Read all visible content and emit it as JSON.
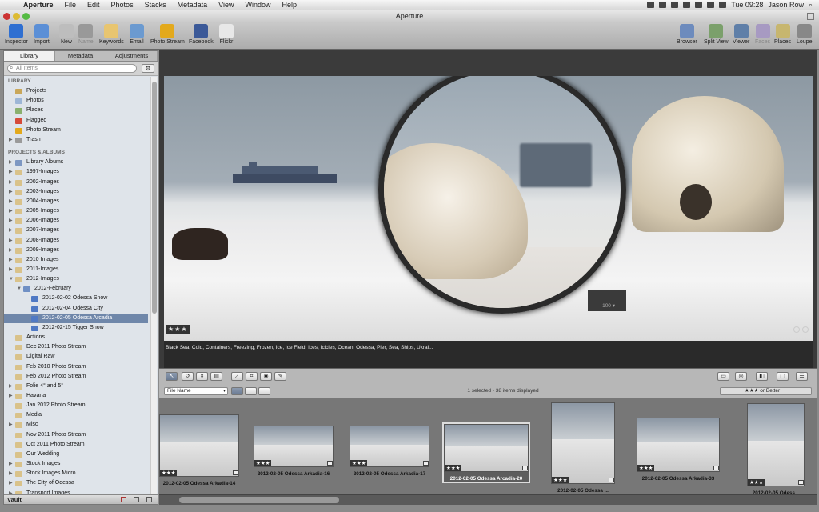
{
  "menubar": {
    "app": "Aperture",
    "items": [
      "File",
      "Edit",
      "Photos",
      "Stacks",
      "Metadata",
      "View",
      "Window",
      "Help"
    ],
    "clock": "Tue 09:28",
    "user": "Jason Row"
  },
  "window": {
    "title": "Aperture"
  },
  "toolbar": {
    "left": [
      {
        "label": "Inspector",
        "icon": "info-icon",
        "color": "#2f6fd1"
      },
      {
        "label": "Import",
        "icon": "import-arrow-icon",
        "color": "#5b8fd6"
      },
      {
        "label": "New",
        "icon": "new-icon",
        "color": "#bdbdbd"
      },
      {
        "label": "Name",
        "icon": "name-person-icon",
        "color": "#999999"
      },
      {
        "label": "Keywords",
        "icon": "keywords-tag-icon",
        "color": "#e8c570"
      },
      {
        "label": "Email",
        "icon": "email-icon",
        "color": "#6b9ad0"
      },
      {
        "label": "Photo Stream",
        "icon": "photo-stream-sunflower-icon",
        "color": "#e3a91c"
      },
      {
        "label": "Facebook",
        "icon": "facebook-icon",
        "color": "#3b5998"
      },
      {
        "label": "Flickr",
        "icon": "flickr-icon",
        "color": "#e8e8e8"
      }
    ],
    "right": [
      {
        "label": "Browser",
        "icon": "browser-grid-icon",
        "color": "#6d8bbd"
      },
      {
        "label": "Split View",
        "icon": "split-view-icon",
        "color": "#7ba06b"
      },
      {
        "label": "Viewer",
        "icon": "viewer-icon",
        "color": "#5f7fa8"
      },
      {
        "label": "Faces",
        "icon": "faces-icon",
        "color": "#a79ac2"
      },
      {
        "label": "Places",
        "icon": "places-map-icon",
        "color": "#c7b66f"
      },
      {
        "label": "Loupe",
        "icon": "loupe-icon",
        "color": "#888888"
      }
    ]
  },
  "sidebar": {
    "tabs": [
      "Library",
      "Metadata",
      "Adjustments"
    ],
    "search_placeholder": "All Items",
    "library_header": "LIBRARY",
    "library_items": [
      {
        "label": "Projects",
        "color": "#c9a75a"
      },
      {
        "label": "Photos",
        "color": "#9db6d6"
      },
      {
        "label": "Places",
        "color": "#8ab06e"
      },
      {
        "label": "Flagged",
        "color": "#d64b3a"
      },
      {
        "label": "Photo Stream",
        "color": "#e3a91c"
      },
      {
        "label": "Trash",
        "color": "#9a9a9a"
      }
    ],
    "projects_header": "PROJECTS & ALBUMS",
    "projects": [
      {
        "label": "Library Albums",
        "depth": 0,
        "tri": "▶",
        "color": "#7d97c2"
      },
      {
        "label": "1997-Images",
        "depth": 0,
        "tri": "▶",
        "color": "#d9c28a"
      },
      {
        "label": "2002-Images",
        "depth": 0,
        "tri": "▶",
        "color": "#d9c28a"
      },
      {
        "label": "2003-Images",
        "depth": 0,
        "tri": "▶",
        "color": "#d9c28a"
      },
      {
        "label": "2004-Images",
        "depth": 0,
        "tri": "▶",
        "color": "#d9c28a"
      },
      {
        "label": "2005-Images",
        "depth": 0,
        "tri": "▶",
        "color": "#d9c28a"
      },
      {
        "label": "2006-Images",
        "depth": 0,
        "tri": "▶",
        "color": "#d9c28a"
      },
      {
        "label": "2007-Images",
        "depth": 0,
        "tri": "▶",
        "color": "#d9c28a"
      },
      {
        "label": "2008-Images",
        "depth": 0,
        "tri": "▶",
        "color": "#d9c28a"
      },
      {
        "label": "2009-Images",
        "depth": 0,
        "tri": "▶",
        "color": "#d9c28a"
      },
      {
        "label": "2010 Images",
        "depth": 0,
        "tri": "▶",
        "color": "#d9c28a"
      },
      {
        "label": "2011-Images",
        "depth": 0,
        "tri": "▶",
        "color": "#d9c28a"
      },
      {
        "label": "2012-Images",
        "depth": 0,
        "tri": "▼",
        "color": "#d9c28a"
      },
      {
        "label": "2012-February",
        "depth": 1,
        "tri": "▼",
        "color": "#6f8fc4"
      },
      {
        "label": "2012-02-02 Odessa Snow",
        "depth": 2,
        "tri": "",
        "color": "#4f79c4"
      },
      {
        "label": "2012-02-04 Odessa City",
        "depth": 2,
        "tri": "",
        "color": "#4f79c4"
      },
      {
        "label": "2012-02-05 Odessa Arcadia",
        "depth": 2,
        "tri": "",
        "color": "#4f79c4",
        "selected": true
      },
      {
        "label": "2012-02-15 Tigger Snow",
        "depth": 2,
        "tri": "",
        "color": "#4f79c4"
      },
      {
        "label": "Actions",
        "depth": 0,
        "tri": "",
        "color": "#d9c28a"
      },
      {
        "label": "Dec 2011 Photo Stream",
        "depth": 0,
        "tri": "",
        "color": "#d9c28a"
      },
      {
        "label": "Digital Raw",
        "depth": 0,
        "tri": "",
        "color": "#d9c28a"
      },
      {
        "label": "Feb 2010 Photo Stream",
        "depth": 0,
        "tri": "",
        "color": "#d9c28a"
      },
      {
        "label": "Feb 2012 Photo Stream",
        "depth": 0,
        "tri": "",
        "color": "#d9c28a"
      },
      {
        "label": "Folie 4° and 5°",
        "depth": 0,
        "tri": "▶",
        "color": "#d9c28a"
      },
      {
        "label": "Havana",
        "depth": 0,
        "tri": "▶",
        "color": "#d9c28a"
      },
      {
        "label": "Jan 2012 Photo Stream",
        "depth": 0,
        "tri": "",
        "color": "#d9c28a"
      },
      {
        "label": "Media",
        "depth": 0,
        "tri": "",
        "color": "#d9c28a"
      },
      {
        "label": "Misc",
        "depth": 0,
        "tri": "▶",
        "color": "#d9c28a"
      },
      {
        "label": "Nov 2011 Photo Stream",
        "depth": 0,
        "tri": "",
        "color": "#d9c28a"
      },
      {
        "label": "Oct 2011 Photo Stream",
        "depth": 0,
        "tri": "",
        "color": "#d9c28a"
      },
      {
        "label": "Our Wedding",
        "depth": 0,
        "tri": "",
        "color": "#d9c28a"
      },
      {
        "label": "Stock Images",
        "depth": 0,
        "tri": "▶",
        "color": "#d9c28a"
      },
      {
        "label": "Stock Images Micro",
        "depth": 0,
        "tri": "▶",
        "color": "#d9c28a"
      },
      {
        "label": "The City of Odessa",
        "depth": 0,
        "tri": "▶",
        "color": "#d9c28a"
      },
      {
        "label": "Transport Images",
        "depth": 0,
        "tri": "▶",
        "color": "#d9c28a"
      }
    ],
    "footer": "Vault"
  },
  "viewer": {
    "rating": "★★★",
    "keywords": "Black Sea, Cold, Containers, Freezing, Frozen, Ice, Ice Field, Ices, Icicles, Ocean, Odessa, Pier, Sea, Ships, Ukrai...",
    "loupe_zoom": "100 ▾"
  },
  "controls": {
    "sort": "File Name",
    "status": "1 selected - 38 items displayed",
    "filter": "★★★ or Better"
  },
  "thumbnails": [
    {
      "caption": "2012-02-05 Odessa Arkadia-14",
      "rating": "★★★"
    },
    {
      "caption": "2012-02-05 Odessa Arkadia-16",
      "rating": "★★★"
    },
    {
      "caption": "2012-02-05 Odessa Arkadia-17",
      "rating": "★★★"
    },
    {
      "caption": "2012-02-05 Odessa Arcadia-20",
      "rating": "★★★",
      "selected": true
    },
    {
      "caption": "2012-02-05 Odessa ...",
      "rating": "★★★"
    },
    {
      "caption": "2012-02-05 Odessa Arkadia-33",
      "rating": "★★★"
    },
    {
      "caption": "2012-02-05 Odess...",
      "rating": "★★★"
    }
  ]
}
